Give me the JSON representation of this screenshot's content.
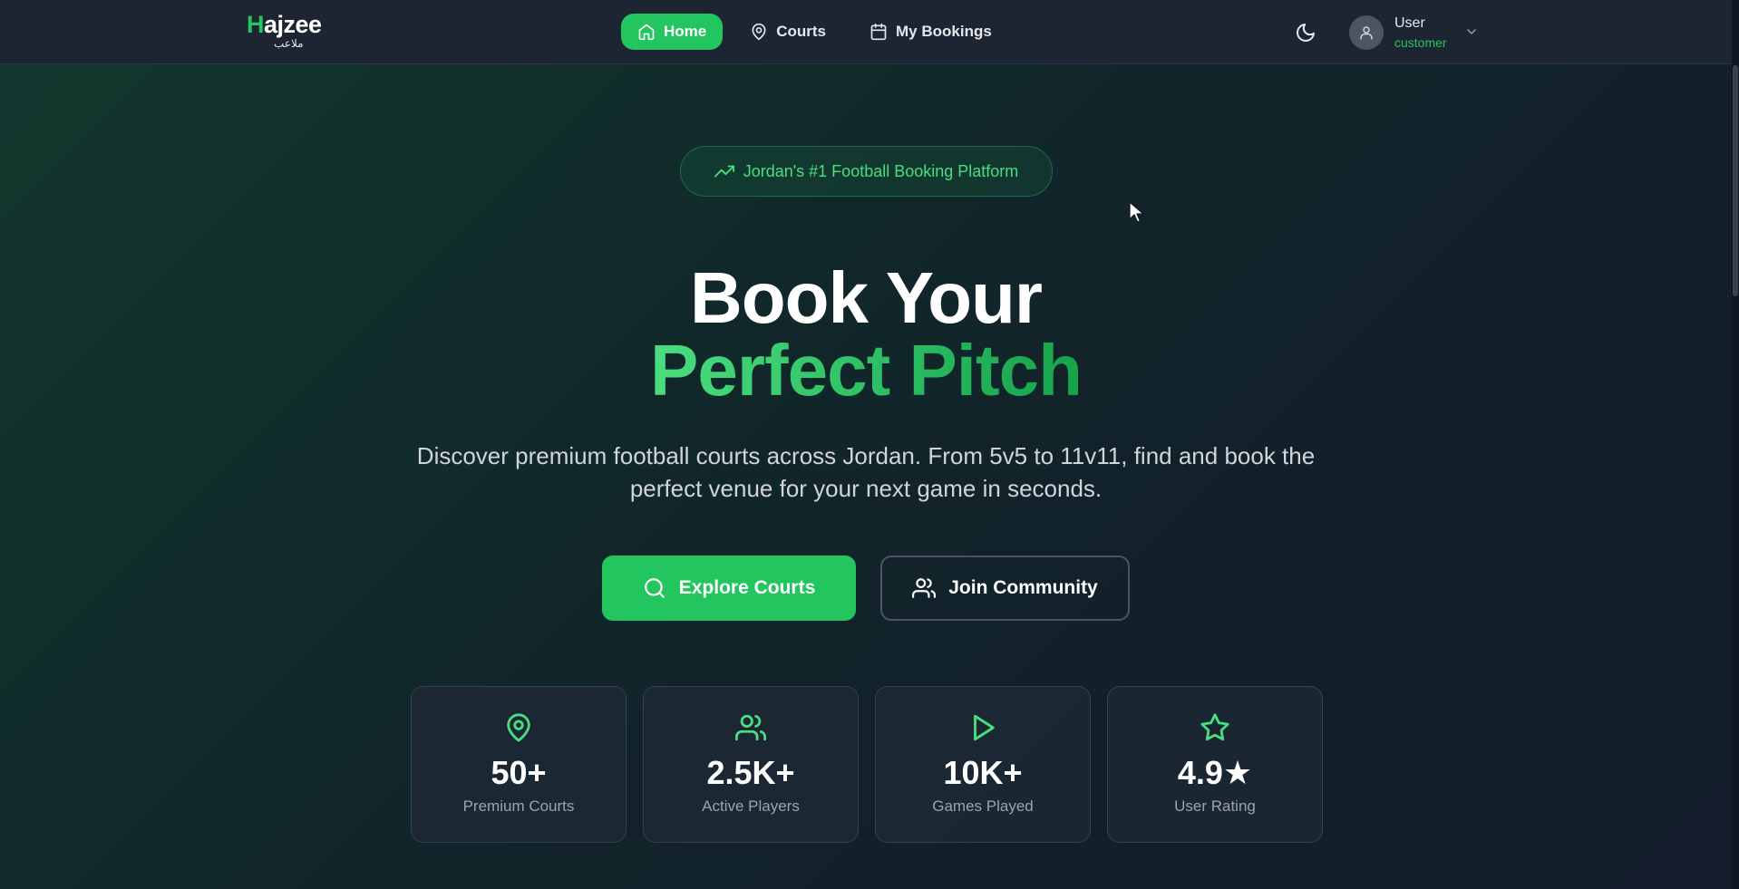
{
  "logo": {
    "text_h": "H",
    "text_rest": "ajzee",
    "subtitle": "ملاعب"
  },
  "nav": {
    "items": [
      {
        "label": "Home",
        "icon": "home-icon",
        "active": true
      },
      {
        "label": "Courts",
        "icon": "map-pin-icon",
        "active": false
      },
      {
        "label": "My Bookings",
        "icon": "calendar-icon",
        "active": false
      }
    ]
  },
  "user": {
    "name": "User",
    "role": "customer"
  },
  "hero": {
    "badge": "Jordan's #1 Football Booking Platform",
    "title_line1": "Book Your",
    "title_line2": "Perfect Pitch",
    "subtitle": "Discover premium football courts across Jordan. From 5v5 to 11v11, find and book the perfect venue for your next game in seconds.",
    "primary_button": "Explore Courts",
    "secondary_button": "Join Community"
  },
  "stats": [
    {
      "value": "50+",
      "label": "Premium Courts",
      "icon": "map-pin-icon"
    },
    {
      "value": "2.5K+",
      "label": "Active Players",
      "icon": "users-icon"
    },
    {
      "value": "10K+",
      "label": "Games Played",
      "icon": "play-icon"
    },
    {
      "value": "4.9★",
      "label": "User Rating",
      "icon": "star-icon"
    }
  ],
  "colors": {
    "accent": "#22c55e",
    "navbar": "#1d2533",
    "card": "#1f2937"
  }
}
